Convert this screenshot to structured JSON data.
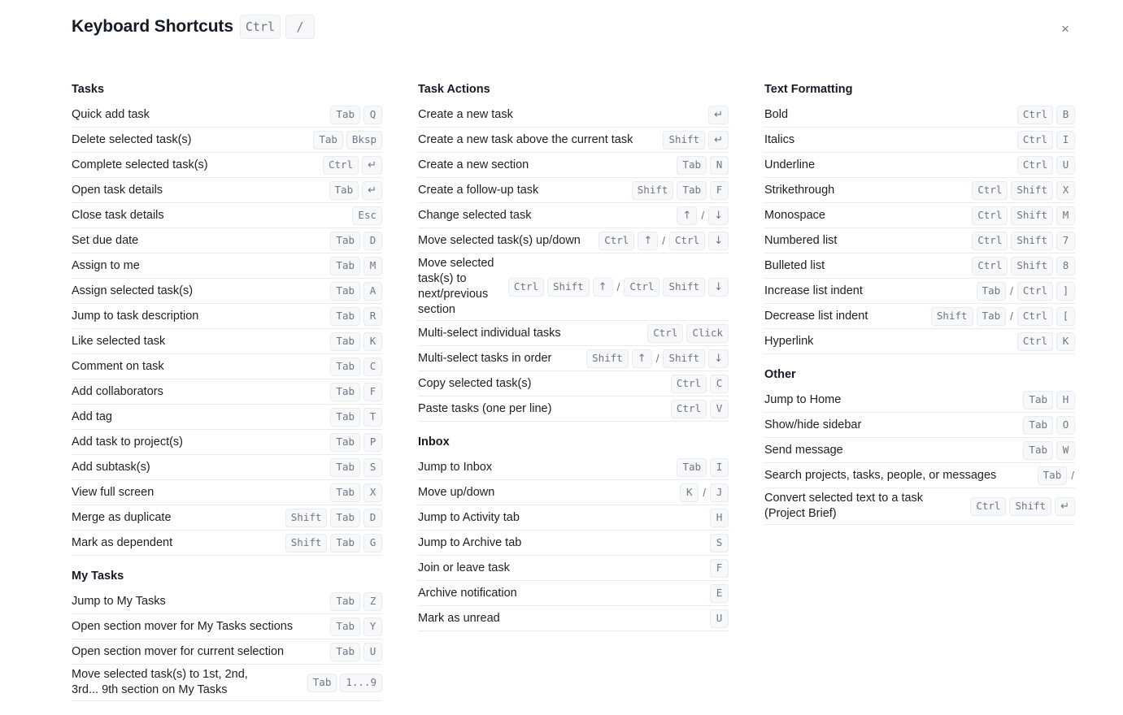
{
  "header": {
    "title": "Keyboard Shortcuts",
    "keys": [
      "Ctrl",
      "/"
    ],
    "close_label": "×"
  },
  "columns": [
    {
      "name": "column-1",
      "sections": [
        {
          "title": "Tasks",
          "rows": [
            {
              "label": "Quick add task",
              "keys": [
                "Tab",
                "Q"
              ]
            },
            {
              "label": "Delete selected task(s)",
              "keys": [
                "Tab",
                "Bksp"
              ]
            },
            {
              "label": "Complete selected task(s)",
              "keys": [
                "Ctrl",
                "↵"
              ]
            },
            {
              "label": "Open task details",
              "keys": [
                "Tab",
                "↵"
              ]
            },
            {
              "label": "Close task details",
              "keys": [
                "Esc"
              ]
            },
            {
              "label": "Set due date",
              "keys": [
                "Tab",
                "D"
              ]
            },
            {
              "label": "Assign to me",
              "keys": [
                "Tab",
                "M"
              ]
            },
            {
              "label": "Assign selected task(s)",
              "keys": [
                "Tab",
                "A"
              ]
            },
            {
              "label": "Jump to task description",
              "keys": [
                "Tab",
                "R"
              ]
            },
            {
              "label": "Like selected task",
              "keys": [
                "Tab",
                "K"
              ]
            },
            {
              "label": "Comment on task",
              "keys": [
                "Tab",
                "C"
              ]
            },
            {
              "label": "Add collaborators",
              "keys": [
                "Tab",
                "F"
              ]
            },
            {
              "label": "Add tag",
              "keys": [
                "Tab",
                "T"
              ]
            },
            {
              "label": "Add task to project(s)",
              "keys": [
                "Tab",
                "P"
              ]
            },
            {
              "label": "Add subtask(s)",
              "keys": [
                "Tab",
                "S"
              ]
            },
            {
              "label": "View full screen",
              "keys": [
                "Tab",
                "X"
              ]
            },
            {
              "label": "Merge as duplicate",
              "keys": [
                "Shift",
                "Tab",
                "D"
              ]
            },
            {
              "label": "Mark as dependent",
              "keys": [
                "Shift",
                "Tab",
                "G"
              ]
            }
          ]
        },
        {
          "title": "My Tasks",
          "rows": [
            {
              "label": "Jump to My Tasks",
              "keys": [
                "Tab",
                "Z"
              ]
            },
            {
              "label": "Open section mover for My Tasks sections",
              "keys": [
                "Tab",
                "Y"
              ]
            },
            {
              "label": "Open section mover for current selection",
              "keys": [
                "Tab",
                "U"
              ]
            },
            {
              "label": "Move selected task(s) to 1st, 2nd, 3rd... 9th section on My Tasks",
              "keys": [
                "Tab",
                "1...9"
              ],
              "wrap": true
            }
          ]
        }
      ]
    },
    {
      "name": "column-2",
      "sections": [
        {
          "title": "Task Actions",
          "rows": [
            {
              "label": "Create a new task",
              "keys": [
                "↵"
              ]
            },
            {
              "label": "Create a new task above the current task",
              "keys": [
                "Shift",
                "↵"
              ]
            },
            {
              "label": "Create a new section",
              "keys": [
                "Tab",
                "N"
              ]
            },
            {
              "label": "Create a follow-up task",
              "keys": [
                "Shift",
                "Tab",
                "F"
              ]
            },
            {
              "label": "Change selected task",
              "keys": [
                "↑",
                "/",
                "↓"
              ]
            },
            {
              "label": "Move selected task(s) up/down",
              "keys": [
                "Ctrl",
                "↑",
                "/",
                "Ctrl",
                "↓"
              ]
            },
            {
              "label": "Move selected task(s) to next/previous section",
              "keys": [
                "Ctrl",
                "Shift",
                "↑",
                "/",
                "Ctrl",
                "Shift",
                "↓"
              ],
              "narrow": true
            },
            {
              "label": "Multi-select individual tasks",
              "keys": [
                "Ctrl",
                "Click"
              ]
            },
            {
              "label": "Multi-select tasks in order",
              "keys": [
                "Shift",
                "↑",
                "/",
                "Shift",
                "↓"
              ]
            },
            {
              "label": "Copy selected task(s)",
              "keys": [
                "Ctrl",
                "C"
              ]
            },
            {
              "label": "Paste tasks (one per line)",
              "keys": [
                "Ctrl",
                "V"
              ]
            }
          ]
        },
        {
          "title": "Inbox",
          "rows": [
            {
              "label": "Jump to Inbox",
              "keys": [
                "Tab",
                "I"
              ]
            },
            {
              "label": "Move up/down",
              "keys": [
                "K",
                "/",
                "J"
              ]
            },
            {
              "label": "Jump to Activity tab",
              "keys": [
                "H"
              ]
            },
            {
              "label": "Jump to Archive tab",
              "keys": [
                "S"
              ]
            },
            {
              "label": "Join or leave task",
              "keys": [
                "F"
              ]
            },
            {
              "label": "Archive notification",
              "keys": [
                "E"
              ]
            },
            {
              "label": "Mark as unread",
              "keys": [
                "U"
              ]
            }
          ]
        }
      ]
    },
    {
      "name": "column-3",
      "sections": [
        {
          "title": "Text Formatting",
          "rows": [
            {
              "label": "Bold",
              "keys": [
                "Ctrl",
                "B"
              ]
            },
            {
              "label": "Italics",
              "keys": [
                "Ctrl",
                "I"
              ]
            },
            {
              "label": "Underline",
              "keys": [
                "Ctrl",
                "U"
              ]
            },
            {
              "label": "Strikethrough",
              "keys": [
                "Ctrl",
                "Shift",
                "X"
              ]
            },
            {
              "label": "Monospace",
              "keys": [
                "Ctrl",
                "Shift",
                "M"
              ]
            },
            {
              "label": "Numbered list",
              "keys": [
                "Ctrl",
                "Shift",
                "7"
              ]
            },
            {
              "label": "Bulleted list",
              "keys": [
                "Ctrl",
                "Shift",
                "8"
              ]
            },
            {
              "label": "Increase list indent",
              "keys": [
                "Tab",
                "/",
                "Ctrl",
                "]"
              ]
            },
            {
              "label": "Decrease list indent",
              "keys": [
                "Shift",
                "Tab",
                "/",
                "Ctrl",
                "["
              ]
            },
            {
              "label": "Hyperlink",
              "keys": [
                "Ctrl",
                "K"
              ]
            }
          ]
        },
        {
          "title": "Other",
          "rows": [
            {
              "label": "Jump to Home",
              "keys": [
                "Tab",
                "H"
              ]
            },
            {
              "label": "Show/hide sidebar",
              "keys": [
                "Tab",
                "O"
              ]
            },
            {
              "label": "Send message",
              "keys": [
                "Tab",
                "W"
              ]
            },
            {
              "label": "Search projects, tasks, people, or messages",
              "keys": [
                "Tab",
                "/"
              ]
            },
            {
              "label": "Convert selected text to a task (Project Brief)",
              "keys": [
                "Ctrl",
                "Shift",
                "↵"
              ],
              "wrap": true
            }
          ]
        }
      ]
    }
  ]
}
